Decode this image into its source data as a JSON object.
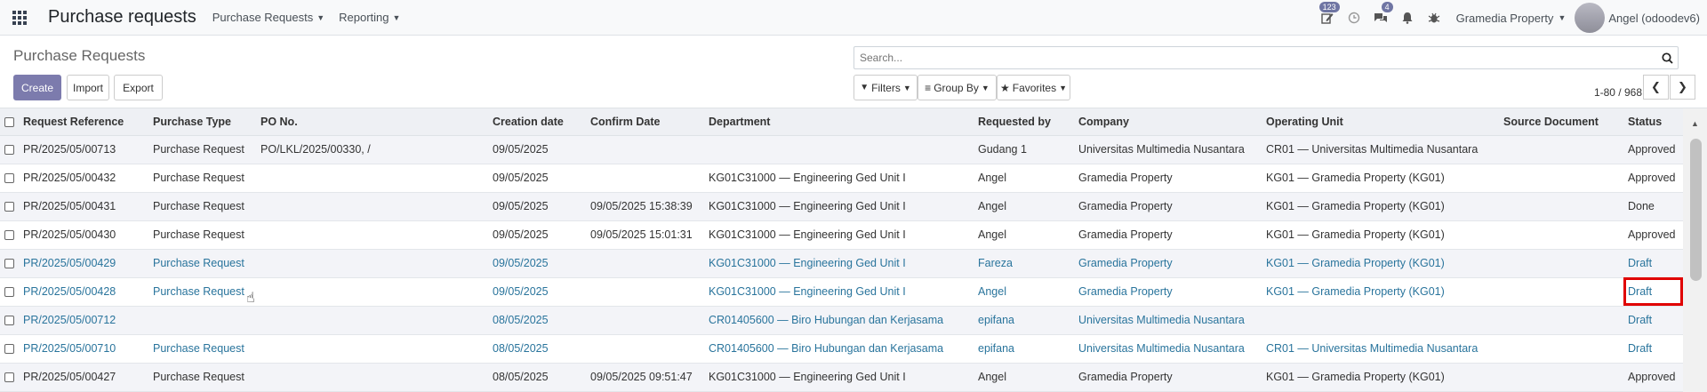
{
  "navbar": {
    "app_title": "Purchase requests",
    "menus": [
      "Purchase Requests",
      "Reporting"
    ],
    "edit_badge": "123",
    "chat_badge": "4",
    "company": "Gramedia Property",
    "user": "Angel (odoodev6)"
  },
  "control": {
    "breadcrumb": "Purchase Requests",
    "create_label": "Create",
    "import_label": "Import",
    "export_label": "Export",
    "search_placeholder": "Search...",
    "filters_label": "Filters",
    "groupby_label": "Group By",
    "favorites_label": "Favorites",
    "pager_text": "1-80 / 968"
  },
  "columns": [
    "Request Reference",
    "Purchase Type",
    "PO No.",
    "Creation date",
    "Confirm Date",
    "Department",
    "Requested by",
    "Company",
    "Operating Unit",
    "Source Document",
    "Status"
  ],
  "rows": [
    {
      "ref": "PR/2025/05/00713",
      "type": "Purchase Request",
      "po": "PO/LKL/2025/00330, /",
      "created": "09/05/2025",
      "confirm": "",
      "dept": "",
      "by": "Gudang 1",
      "company": "Universitas Multimedia Nusantara",
      "ou": "CR01 — Universitas Multimedia Nusantara",
      "source": "",
      "status": "Approved"
    },
    {
      "ref": "PR/2025/05/00432",
      "type": "Purchase Request",
      "po": "",
      "created": "09/05/2025",
      "confirm": "",
      "dept": "KG01C31000 — Engineering Ged Unit I",
      "by": "Angel",
      "company": "Gramedia Property",
      "ou": "KG01 — Gramedia Property (KG01)",
      "source": "",
      "status": "Approved"
    },
    {
      "ref": "PR/2025/05/00431",
      "type": "Purchase Request",
      "po": "",
      "created": "09/05/2025",
      "confirm": "09/05/2025 15:38:39",
      "dept": "KG01C31000 — Engineering Ged Unit I",
      "by": "Angel",
      "company": "Gramedia Property",
      "ou": "KG01 — Gramedia Property (KG01)",
      "source": "",
      "status": "Done"
    },
    {
      "ref": "PR/2025/05/00430",
      "type": "Purchase Request",
      "po": "",
      "created": "09/05/2025",
      "confirm": "09/05/2025 15:01:31",
      "dept": "KG01C31000 — Engineering Ged Unit I",
      "by": "Angel",
      "company": "Gramedia Property",
      "ou": "KG01 — Gramedia Property (KG01)",
      "source": "",
      "status": "Approved"
    },
    {
      "ref": "PR/2025/05/00429",
      "type": "Purchase Request",
      "po": "",
      "created": "09/05/2025",
      "confirm": "",
      "dept": "KG01C31000 — Engineering Ged Unit I",
      "by": "Fareza",
      "company": "Gramedia Property",
      "ou": "KG01 — Gramedia Property (KG01)",
      "source": "",
      "status": "Draft"
    },
    {
      "ref": "PR/2025/05/00428",
      "type": "Purchase Request",
      "po": "",
      "created": "09/05/2025",
      "confirm": "",
      "dept": "KG01C31000 — Engineering Ged Unit I",
      "by": "Angel",
      "company": "Gramedia Property",
      "ou": "KG01 — Gramedia Property (KG01)",
      "source": "",
      "status": "Draft"
    },
    {
      "ref": "PR/2025/05/00712",
      "type": "",
      "po": "",
      "created": "08/05/2025",
      "confirm": "",
      "dept": "CR01405600 — Biro Hubungan dan Kerjasama",
      "by": "epifana",
      "company": "Universitas Multimedia Nusantara",
      "ou": "",
      "source": "",
      "status": "Draft"
    },
    {
      "ref": "PR/2025/05/00710",
      "type": "Purchase Request",
      "po": "",
      "created": "08/05/2025",
      "confirm": "",
      "dept": "CR01405600 — Biro Hubungan dan Kerjasama",
      "by": "epifana",
      "company": "Universitas Multimedia Nusantara",
      "ou": "CR01 — Universitas Multimedia Nusantara",
      "source": "",
      "status": "Draft"
    },
    {
      "ref": "PR/2025/05/00427",
      "type": "Purchase Request",
      "po": "",
      "created": "08/05/2025",
      "confirm": "09/05/2025 09:51:47",
      "dept": "KG01C31000 — Engineering Ged Unit I",
      "by": "Angel",
      "company": "Gramedia Property",
      "ou": "KG01 — Gramedia Property (KG01)",
      "source": "",
      "status": "Approved"
    }
  ],
  "highlight": {
    "row_index": 5,
    "column": "status",
    "color": "#e00000"
  },
  "colors": {
    "primary": "#7c7bad",
    "draft_link": "#29749c",
    "badge": "#6f75a3"
  }
}
